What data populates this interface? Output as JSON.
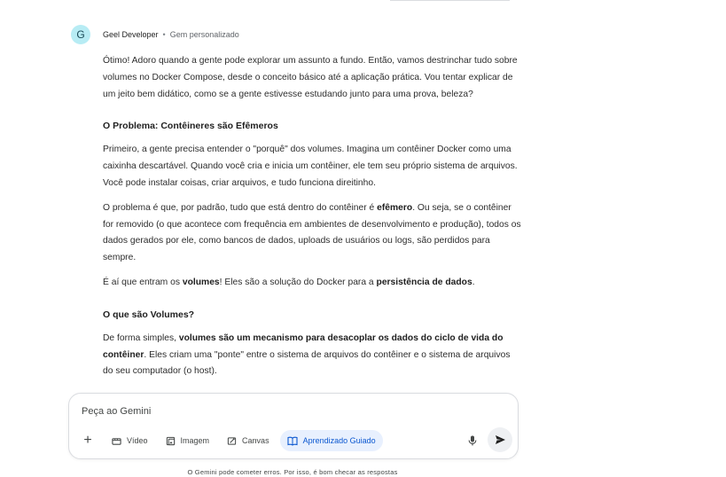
{
  "header": {
    "avatar_letter": "G",
    "gem_name": "Geel Developer",
    "separator": "•",
    "gem_type": "Gem personalizado"
  },
  "response": {
    "intro": "Ótimo! Adoro quando a gente pode explorar um assunto a fundo. Então, vamos destrinchar tudo sobre volumes no Docker Compose, desde o conceito básico até a aplicação prática. Vou tentar explicar de um jeito bem didático, como se a gente estivesse estudando junto para uma prova, beleza?",
    "section1_title": "O Problema: Contêineres são Efêmeros",
    "section1_p1": "Primeiro, a gente precisa entender o \"porquê\" dos volumes. Imagina um contêiner Docker como uma caixinha descartável. Quando você cria e inicia um contêiner, ele tem seu próprio sistema de arquivos. Você pode instalar coisas, criar arquivos, e tudo funciona direitinho.",
    "section1_p2_a": "O problema é que, por padrão, tudo que está dentro do contêiner é ",
    "section1_p2_bold": "efêmero",
    "section1_p2_b": ". Ou seja, se o contêiner for removido (o que acontece com frequência em ambientes de desenvolvimento e produção), todos os dados gerados por ele, como bancos de dados, uploads de usuários ou logs, são perdidos para sempre.",
    "section1_p3_a": "É aí que entram os ",
    "section1_p3_bold1": "volumes",
    "section1_p3_b": "! Eles são a solução do Docker para a ",
    "section1_p3_bold2": "persistência de dados",
    "section1_p3_c": ".",
    "section2_title": "O que são Volumes?",
    "section2_p1_a": "De forma simples, ",
    "section2_p1_bold": "volumes são um mecanismo para desacoplar os dados do ciclo de vida do contêiner",
    "section2_p1_b": ". Eles criam uma \"ponte\" entre o sistema de arquivos do contêiner e o sistema de arquivos do seu computador (o host)."
  },
  "composer": {
    "placeholder": "Peça ao Gemini",
    "plus_label": "+",
    "tools": [
      {
        "label": "Vídeo",
        "icon": "video-icon"
      },
      {
        "label": "Imagem",
        "icon": "image-icon"
      },
      {
        "label": "Canvas",
        "icon": "canvas-icon"
      },
      {
        "label": "Aprendizado Guiado",
        "icon": "book-icon"
      }
    ],
    "active_color": "#0b57d0"
  },
  "disclaimer": "O Gemini pode cometer erros. Por isso, é bom checar as respostas"
}
